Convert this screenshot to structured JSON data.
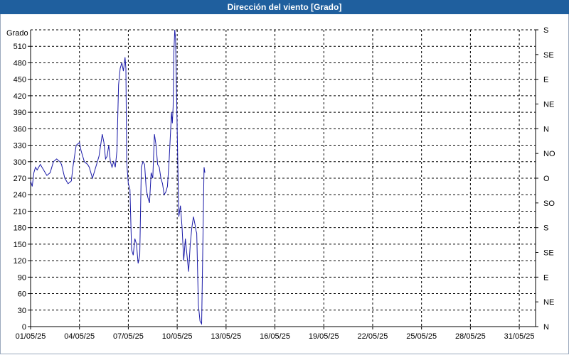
{
  "window": {
    "title": "Dirección del viento [Grado]"
  },
  "chart_data": {
    "type": "line",
    "title": "Dirección del viento [Grado]",
    "ylabel": "Grado",
    "ylim": [
      0,
      540
    ],
    "xlim": [
      0,
      31
    ],
    "grid": true,
    "y_ticks": [
      0,
      30,
      60,
      90,
      120,
      150,
      180,
      210,
      240,
      270,
      300,
      330,
      360,
      390,
      420,
      450,
      480,
      510
    ],
    "x_ticks": [
      0,
      3,
      6,
      9,
      12,
      15,
      18,
      21,
      24,
      27,
      30
    ],
    "x_tick_labels": [
      "01/05/25",
      "04/05/25",
      "07/05/25",
      "10/05/25",
      "13/05/25",
      "16/05/25",
      "19/05/25",
      "22/05/25",
      "25/05/25",
      "28/05/25",
      "31/05/25"
    ],
    "right_axis_labels": [
      "N",
      "NE",
      "E",
      "SE",
      "S",
      "SO",
      "O",
      "NO",
      "N",
      "NE",
      "E",
      "SE",
      "S"
    ],
    "right_axis_values": [
      0,
      45,
      90,
      135,
      180,
      225,
      270,
      315,
      360,
      405,
      450,
      495,
      540
    ],
    "line_color": "#1a1aa8",
    "series": [
      {
        "x": [
          0.0,
          0.1,
          0.2,
          0.3,
          0.4,
          0.6,
          0.8,
          1.0,
          1.2,
          1.4,
          1.6,
          1.8,
          1.9,
          2.1,
          2.3,
          2.5,
          2.6,
          2.8,
          3.0,
          3.1,
          3.3,
          3.5,
          3.6,
          3.8,
          4.0,
          4.2,
          4.4,
          4.5,
          4.6,
          4.7,
          4.8,
          4.9,
          5.0,
          5.1,
          5.2,
          5.3,
          5.4,
          5.5,
          5.6,
          5.7,
          5.8,
          5.85,
          5.9,
          6.0,
          6.1,
          6.2,
          6.3,
          6.4,
          6.5,
          6.6,
          6.7,
          6.8,
          6.9,
          7.0,
          7.1,
          7.2,
          7.3,
          7.4,
          7.5,
          7.6,
          7.7,
          7.8,
          7.9,
          8.0,
          8.1,
          8.2,
          8.3,
          8.4,
          8.5,
          8.6,
          8.65,
          8.7,
          8.75,
          8.8,
          8.85,
          8.9,
          9.0,
          9.1,
          9.2,
          9.3,
          9.4,
          9.5,
          9.6,
          9.7,
          9.8,
          9.9,
          10.0,
          10.1,
          10.15,
          10.2,
          10.3,
          10.4,
          10.5,
          10.6,
          10.65,
          10.7
        ],
        "y": [
          265,
          255,
          280,
          290,
          285,
          295,
          285,
          275,
          280,
          300,
          305,
          300,
          295,
          270,
          260,
          265,
          290,
          330,
          335,
          320,
          300,
          295,
          290,
          270,
          290,
          310,
          350,
          335,
          305,
          310,
          330,
          300,
          290,
          300,
          290,
          320,
          440,
          470,
          480,
          465,
          490,
          470,
          300,
          260,
          250,
          140,
          130,
          160,
          150,
          115,
          130,
          290,
          300,
          295,
          250,
          235,
          225,
          280,
          270,
          350,
          330,
          295,
          290,
          270,
          260,
          240,
          245,
          255,
          300,
          360,
          390,
          370,
          400,
          500,
          540,
          525,
          360,
          200,
          220,
          180,
          120,
          160,
          130,
          100,
          150,
          180,
          200,
          185,
          175,
          170,
          40,
          10,
          5,
          200,
          290,
          280
        ]
      }
    ]
  }
}
